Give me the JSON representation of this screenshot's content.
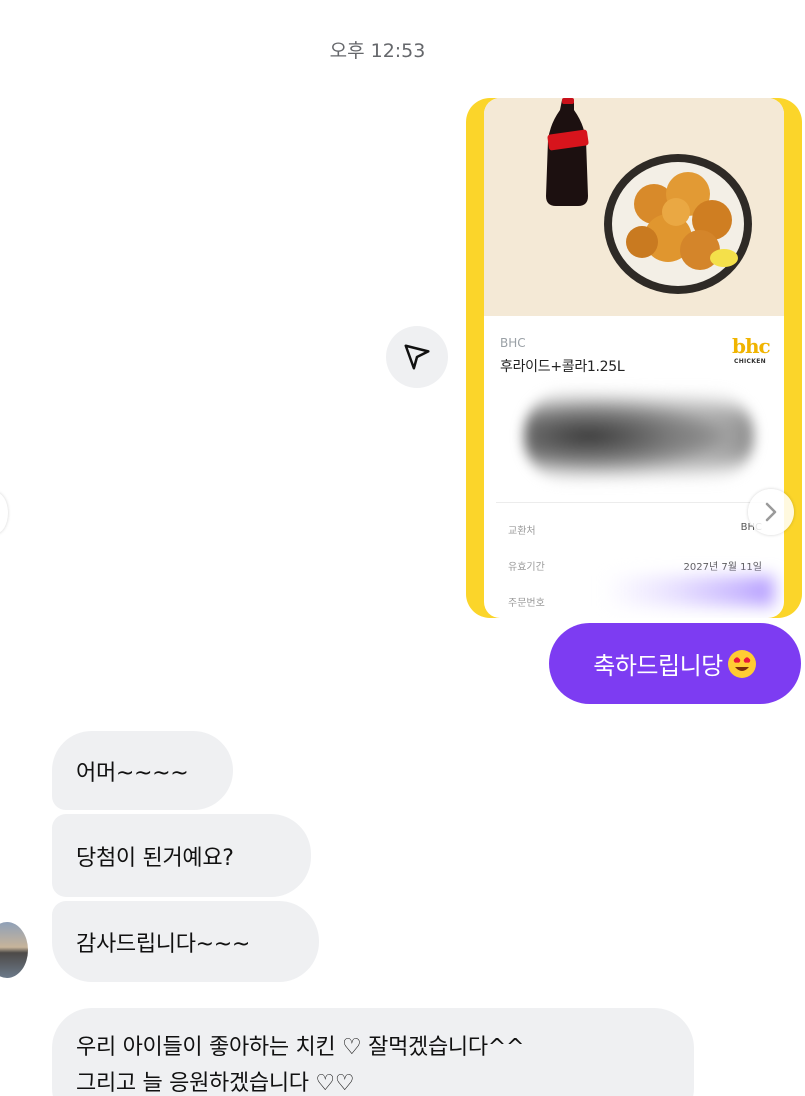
{
  "timestamp": "오후 12:53",
  "gift_card": {
    "brand": "BHC",
    "product": "후라이드+콜라1.25L",
    "logo_text": "bhc",
    "logo_sub": "CHICKEN",
    "rows": [
      {
        "label": "교환처",
        "value": "BHC"
      },
      {
        "label": "유효기간",
        "value": "2027년 7월 11일"
      },
      {
        "label": "주문번호",
        "value": ""
      }
    ]
  },
  "sent_message": {
    "text": "축하드립니당",
    "emoji": "heart-eyes-emoji"
  },
  "received_messages": [
    {
      "text": "어머~~~~"
    },
    {
      "text": "당첨이 된거예요?"
    },
    {
      "text": "감사드립니다~~~"
    },
    {
      "line1": "우리 아이들이 좋아하는 치킨 ♡  잘먹겠습니다^^",
      "line2": "그리고 늘 응원하겠습니다 ♡♡"
    }
  ],
  "colors": {
    "accent": "#7d3cf2",
    "card_border": "#fbd52a",
    "bubble_received": "#eff0f2"
  }
}
